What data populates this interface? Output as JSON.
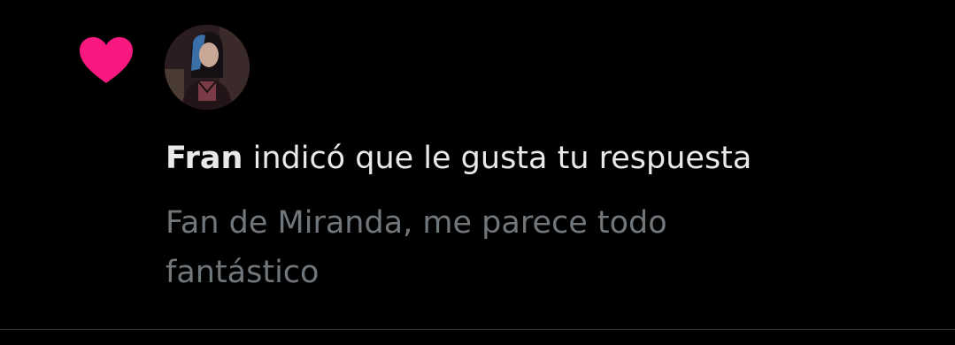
{
  "notification": {
    "type_icon": "heart-icon",
    "icon_color": "#f91880",
    "avatar_alt": "Fran",
    "user_name": "Fran",
    "action_text": " indicó que le gusta tu respuesta",
    "reply_text": "Fan de Miranda, me parece todo fantástico"
  },
  "colors": {
    "background": "#000000",
    "primary_text": "#e7e9ea",
    "secondary_text": "#71767b",
    "divider": "#2f3336"
  }
}
